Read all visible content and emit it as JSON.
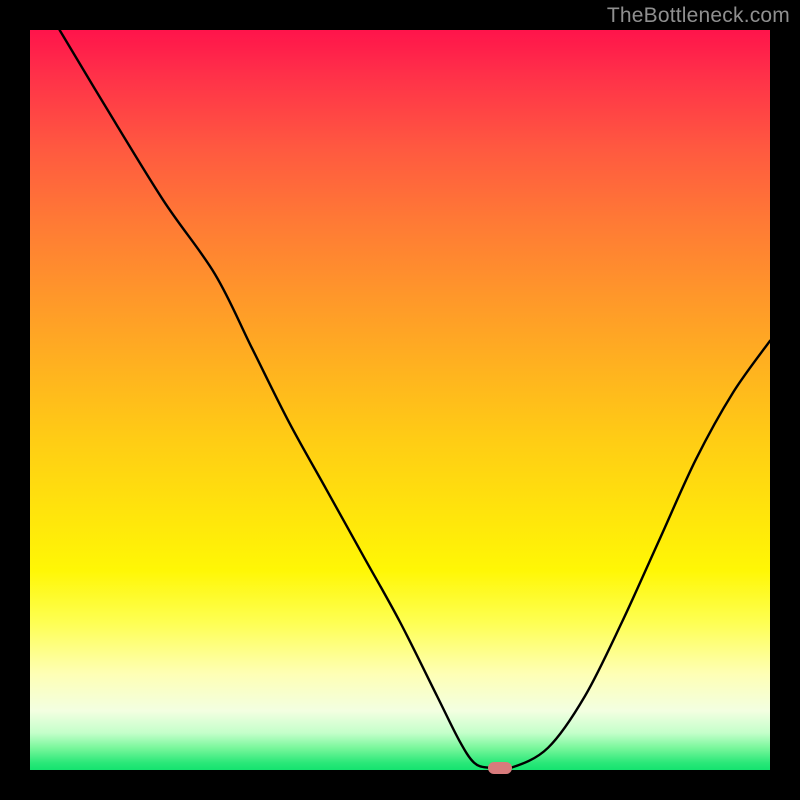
{
  "watermark": "TheBottleneck.com",
  "chart_data": {
    "type": "line",
    "title": "",
    "xlabel": "",
    "ylabel": "",
    "xlim": [
      0,
      100
    ],
    "ylim": [
      0,
      100
    ],
    "grid": false,
    "legend": false,
    "background_gradient": {
      "top": "#ff144b",
      "upper_mid": "#ff972a",
      "mid": "#ffe60b",
      "lower_mid": "#feffb5",
      "bottom": "#14e36f"
    },
    "series": [
      {
        "name": "bottleneck-curve",
        "color": "#000000",
        "x": [
          4,
          10,
          18,
          25,
          30,
          35,
          40,
          45,
          50,
          55,
          58,
          60,
          62,
          65,
          70,
          75,
          80,
          85,
          90,
          95,
          100
        ],
        "y": [
          100,
          90,
          77,
          67,
          57,
          47,
          38,
          29,
          20,
          10,
          4,
          1,
          0.3,
          0.3,
          3,
          10,
          20,
          31,
          42,
          51,
          58
        ]
      }
    ],
    "marker": {
      "x": 63.5,
      "y": 0.3,
      "color": "#d87b7c",
      "shape": "pill"
    }
  }
}
